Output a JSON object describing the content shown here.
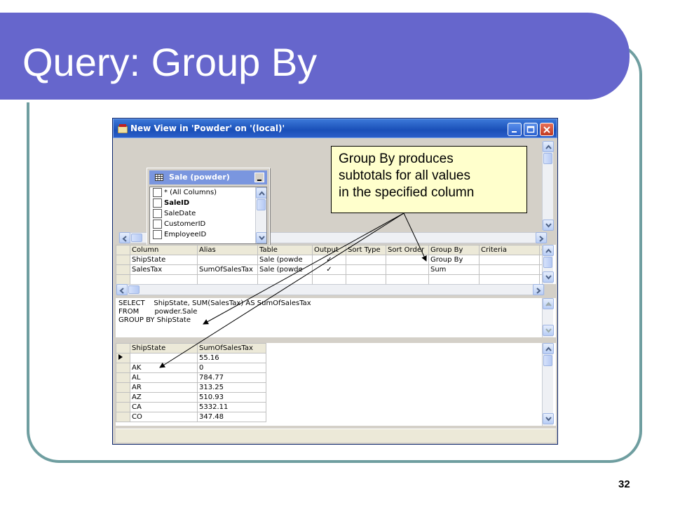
{
  "slide": {
    "title": "Query: Group By",
    "page_number": "32"
  },
  "window": {
    "title": "New View in 'Powder' on '(local)'"
  },
  "table_box": {
    "name": "Sale (powder)",
    "columns": [
      {
        "label": "* (All Columns)",
        "bold": false
      },
      {
        "label": "SaleID",
        "bold": true
      },
      {
        "label": "SaleDate",
        "bold": false
      },
      {
        "label": "CustomerID",
        "bold": false
      },
      {
        "label": "EmployeeID",
        "bold": false
      }
    ]
  },
  "callout": {
    "text": "Group By produces subtotals for all values in the specified column",
    "lines": [
      "Group By produces",
      "subtotals for all values",
      "in the specified column"
    ]
  },
  "grid": {
    "headers": [
      "Column",
      "Alias",
      "Table",
      "Output",
      "Sort Type",
      "Sort Order",
      "Group By",
      "Criteria",
      "("
    ],
    "rows": [
      [
        "ShipState",
        "",
        "Sale (powde",
        "✓",
        "",
        "",
        "Group By",
        "",
        ""
      ],
      [
        "SalesTax",
        "SumOfSalesTax",
        "Sale (powde",
        "✓",
        "",
        "",
        "Sum",
        "",
        ""
      ]
    ]
  },
  "sql": {
    "lines": [
      "SELECT    ShipState, SUM(SalesTax) AS SumOfSalesTax",
      "FROM       powder.Sale",
      "GROUP BY ShipState"
    ]
  },
  "results": {
    "headers": [
      "ShipState",
      "SumOfSalesTax"
    ],
    "rows": [
      [
        "",
        "55.16"
      ],
      [
        "AK",
        "0"
      ],
      [
        "AL",
        "784.77"
      ],
      [
        "AR",
        "313.25"
      ],
      [
        "AZ",
        "510.93"
      ],
      [
        "CA",
        "5332.11"
      ],
      [
        "CO",
        "347.48"
      ]
    ]
  },
  "colors": {
    "title_bar": "#6666cc",
    "frame": "#6f9ea0",
    "callout": "#ffffcc"
  }
}
